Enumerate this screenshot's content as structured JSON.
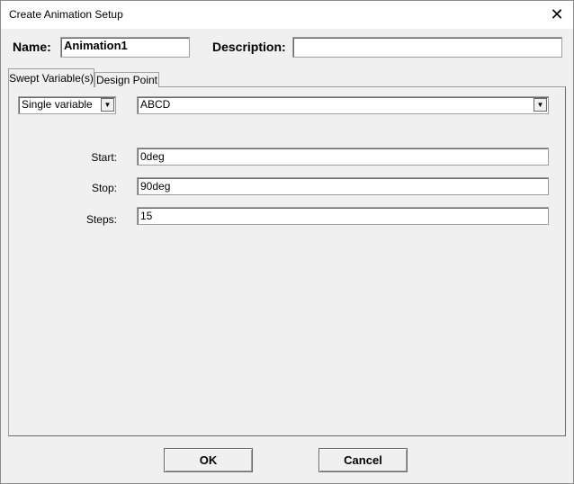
{
  "window": {
    "title": "Create Animation Setup",
    "close_icon": "close-icon"
  },
  "form": {
    "name_label": "Name:",
    "name_value": "Animation1",
    "description_label": "Description:",
    "description_value": ""
  },
  "tabs": [
    {
      "label": "Swept Variable(s)",
      "active": true
    },
    {
      "label": "Design Point",
      "active": false
    }
  ],
  "swept": {
    "mode": "Single variable",
    "variable": "ABCD",
    "start_label": "Start:",
    "start_value": "0deg",
    "stop_label": "Stop:",
    "stop_value": "90deg",
    "steps_label": "Steps:",
    "steps_value": "15"
  },
  "buttons": {
    "ok": "OK",
    "cancel": "Cancel"
  }
}
